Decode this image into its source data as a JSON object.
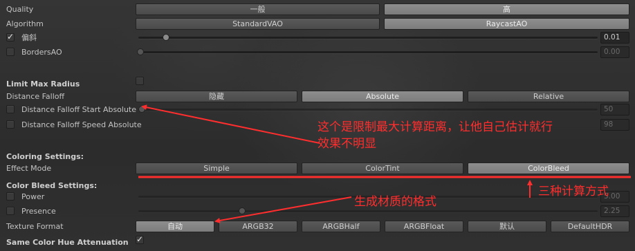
{
  "rows": {
    "quality": {
      "label": "Quality",
      "options": [
        "一般",
        "高"
      ]
    },
    "algorithm": {
      "label": "Algorithm",
      "options": [
        "StandardVAO",
        "RaycastAO"
      ]
    },
    "skew": {
      "label": "偏斜",
      "checked": true,
      "value": "0.01",
      "slider_level": 0.06
    },
    "borders_ao": {
      "label": "BordersAO",
      "checked": false,
      "value": "0.00",
      "slider_level": 0.0
    },
    "limit_max_radius": {
      "label": "Limit Max Radius",
      "checked": false
    },
    "distance_falloff": {
      "label": "Distance Falloff",
      "options": [
        "隐藏",
        "Absolute",
        "Relative"
      ]
    },
    "falloff_start": {
      "label": "Distance Falloff Start Absolute",
      "checked": false,
      "value": "50"
    },
    "falloff_speed": {
      "label": "Distance Falloff Speed Absolute",
      "checked": false,
      "value": "98"
    },
    "coloring_settings": {
      "label": "Coloring Settings:"
    },
    "effect_mode": {
      "label": "Effect Mode",
      "options": [
        "Simple",
        "ColorTint",
        "ColorBleed"
      ]
    },
    "color_bleed_settings": {
      "label": "Color Bleed Settings:"
    },
    "power": {
      "label": "Power",
      "checked": false,
      "value": "5.00"
    },
    "presence": {
      "label": "Presence",
      "checked": false,
      "value": "2.25",
      "slider_level": 0.22
    },
    "texture_format": {
      "label": "Texture Format",
      "options": [
        "自动",
        "ARGB32",
        "ARGBHalf",
        "ARGBFloat",
        "默认",
        "DefaultHDR"
      ]
    },
    "same_hue": {
      "label": "Same Color Hue Attenuation",
      "checked": true
    }
  },
  "annotations": {
    "radius_note_line1": "这个是限制最大计算距离，让他自己估计就行",
    "radius_note_line2": "效果不明显",
    "modes_note": "三种计算方式",
    "format_note": "生成材质的格式",
    "color": "#ff2e2e"
  }
}
